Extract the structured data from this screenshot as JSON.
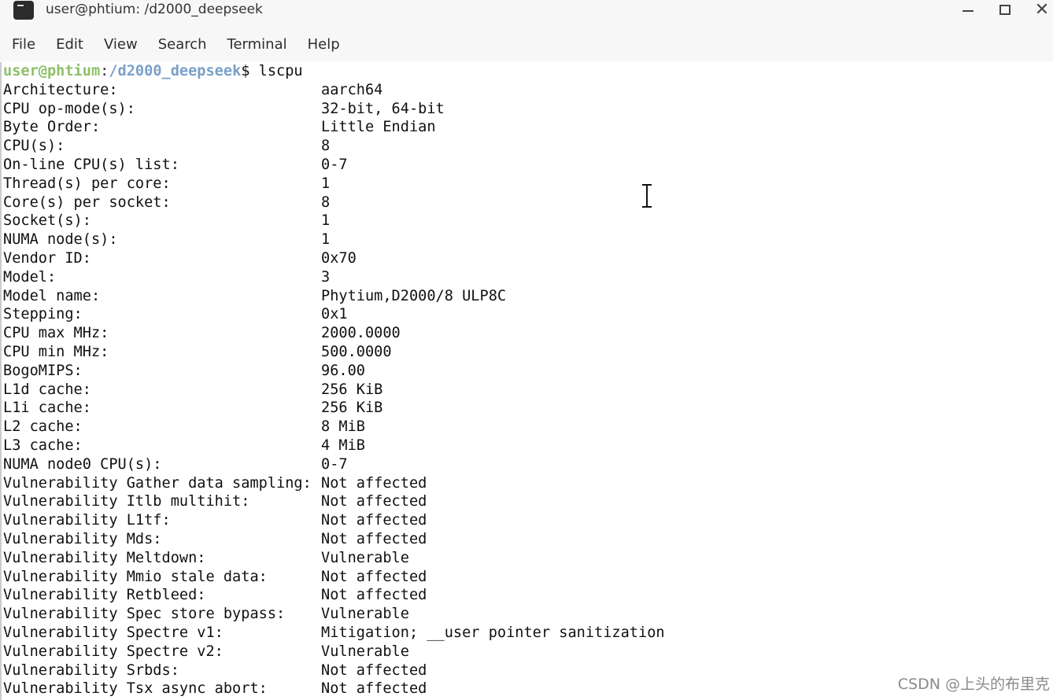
{
  "window": {
    "title": "user@phtium: /d2000_deepseek",
    "icon": "terminal-icon",
    "controls": {
      "minimize": "minimize-icon",
      "maximize": "maximize-icon",
      "close": "✕"
    }
  },
  "menu": {
    "items": [
      "File",
      "Edit",
      "View",
      "Search",
      "Terminal",
      "Help"
    ]
  },
  "terminal": {
    "prompt": {
      "user_host": "user@phtium",
      "separator": ":",
      "path": "/d2000_deepseek",
      "dollar": "$ ",
      "command": "lscpu"
    },
    "rows": [
      {
        "label": "Architecture:",
        "value": "aarch64"
      },
      {
        "label": "CPU op-mode(s):",
        "value": "32-bit, 64-bit"
      },
      {
        "label": "Byte Order:",
        "value": "Little Endian"
      },
      {
        "label": "CPU(s):",
        "value": "8"
      },
      {
        "label": "On-line CPU(s) list:",
        "value": "0-7"
      },
      {
        "label": "Thread(s) per core:",
        "value": "1"
      },
      {
        "label": "Core(s) per socket:",
        "value": "8"
      },
      {
        "label": "Socket(s):",
        "value": "1"
      },
      {
        "label": "NUMA node(s):",
        "value": "1"
      },
      {
        "label": "Vendor ID:",
        "value": "0x70"
      },
      {
        "label": "Model:",
        "value": "3"
      },
      {
        "label": "Model name:",
        "value": "Phytium,D2000/8 ULP8C"
      },
      {
        "label": "Stepping:",
        "value": "0x1"
      },
      {
        "label": "CPU max MHz:",
        "value": "2000.0000"
      },
      {
        "label": "CPU min MHz:",
        "value": "500.0000"
      },
      {
        "label": "BogoMIPS:",
        "value": "96.00"
      },
      {
        "label": "L1d cache:",
        "value": "256 KiB"
      },
      {
        "label": "L1i cache:",
        "value": "256 KiB"
      },
      {
        "label": "L2 cache:",
        "value": "8 MiB"
      },
      {
        "label": "L3 cache:",
        "value": "4 MiB"
      },
      {
        "label": "NUMA node0 CPU(s):",
        "value": "0-7"
      },
      {
        "label": "Vulnerability Gather data sampling:",
        "value": "Not affected"
      },
      {
        "label": "Vulnerability Itlb multihit:",
        "value": "Not affected"
      },
      {
        "label": "Vulnerability L1tf:",
        "value": "Not affected"
      },
      {
        "label": "Vulnerability Mds:",
        "value": "Not affected"
      },
      {
        "label": "Vulnerability Meltdown:",
        "value": "Vulnerable"
      },
      {
        "label": "Vulnerability Mmio stale data:",
        "value": "Not affected"
      },
      {
        "label": "Vulnerability Retbleed:",
        "value": "Not affected"
      },
      {
        "label": "Vulnerability Spec store bypass:",
        "value": "Vulnerable"
      },
      {
        "label": "Vulnerability Spectre v1:",
        "value": "Mitigation; __user pointer sanitization"
      },
      {
        "label": "Vulnerability Spectre v2:",
        "value": "Vulnerable"
      },
      {
        "label": "Vulnerability Srbds:",
        "value": "Not affected"
      },
      {
        "label": "Vulnerability Tsx async abort:",
        "value": "Not affected"
      }
    ]
  },
  "watermark": "CSDN @上头的布里克",
  "colors": {
    "prompt_user": "#8fc06a",
    "prompt_path": "#7aa0c8",
    "text": "#111111",
    "chrome_bg": "#f7f7f7"
  }
}
